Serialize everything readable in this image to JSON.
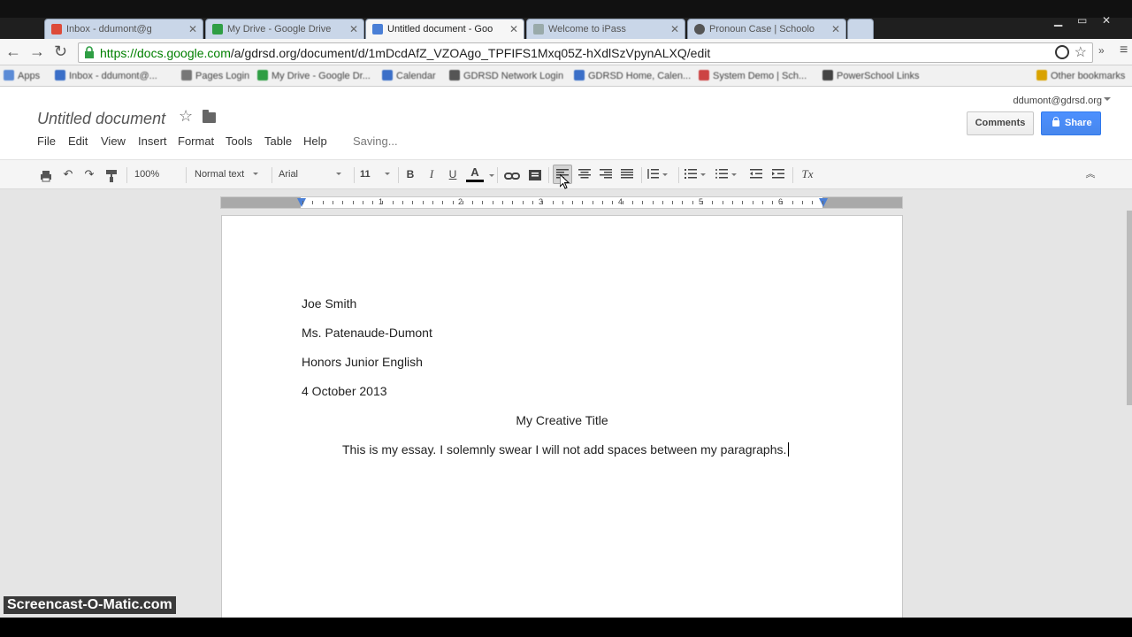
{
  "tabs": [
    {
      "title": "Inbox - ddumont@g",
      "favicon_color": "#dd4b39"
    },
    {
      "title": "My Drive - Google Drive",
      "favicon_color": "#2f9e44"
    },
    {
      "title": "Untitled document - Goo",
      "favicon_color": "#4a7fd6",
      "active": true
    },
    {
      "title": "Welcome to iPass",
      "favicon_color": "#9aa"
    },
    {
      "title": "Pronoun Case | Schoolo",
      "favicon_color": "#555"
    }
  ],
  "omnibox": {
    "url_host": "https://docs.google.com",
    "url_path": "/a/gdrsd.org/document/d/1mDcdAfZ_VZOAgo_TPFIFS1Mxq05Z-hXdlSzVpynALXQ/edit"
  },
  "bookmarks": [
    {
      "label": "Apps",
      "color": "#5b8bd6"
    },
    {
      "label": "Inbox - ddumont@...",
      "color": "#3b6fc8"
    },
    {
      "label": "Pages Login",
      "color": "#777"
    },
    {
      "label": "My Drive - Google Dr...",
      "color": "#2f9e44"
    },
    {
      "label": "Calendar",
      "color": "#3b6fc8"
    },
    {
      "label": "GDRSD Network Login",
      "color": "#555"
    },
    {
      "label": "GDRSD Home, Calen...",
      "color": "#3b6fc8"
    },
    {
      "label": "System Demo | Sch...",
      "color": "#c44"
    },
    {
      "label": "PowerSchool Links",
      "color": "#444"
    },
    {
      "label": "Other bookmarks",
      "color": "#d9a300"
    }
  ],
  "doc": {
    "title": "Untitled document",
    "status": "Saving...",
    "account": "ddumont@gdrsd.org",
    "comments_label": "Comments",
    "share_label": "Share"
  },
  "menu": [
    "File",
    "Edit",
    "View",
    "Insert",
    "Format",
    "Tools",
    "Table",
    "Help"
  ],
  "toolbar": {
    "zoom": "100%",
    "style": "Normal text",
    "font": "Arial",
    "size": "11",
    "bold": "B",
    "italic": "I",
    "underline": "U",
    "text_color": "A",
    "clear_format": "Tx"
  },
  "ruler_numbers": [
    "1",
    "2",
    "3",
    "4",
    "5",
    "6"
  ],
  "content": {
    "name": "Joe Smith",
    "teacher": "Ms. Patenaude-Dumont",
    "course": "Honors Junior English",
    "date": "4 October 2013",
    "title": "My Creative Title",
    "body": "This is my essay. I solemnly swear I will not add spaces between my paragraphs."
  },
  "watermark": "Screencast-O-Matic.com"
}
